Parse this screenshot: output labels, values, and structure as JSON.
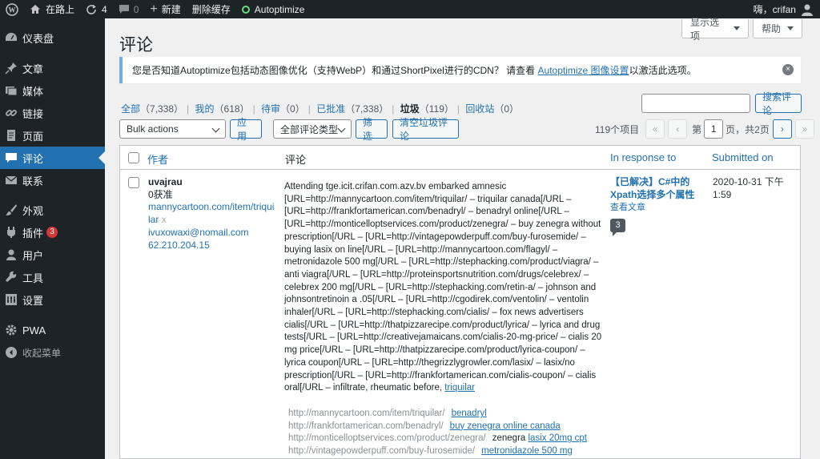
{
  "adminbar": {
    "site_name": "在路上",
    "updates_count": "4",
    "comments_count": "0",
    "new_label": "新建",
    "purge_cache_label": "删除缓存",
    "autoptimize_label": "Autoptimize",
    "greeting": "嗨，crifan"
  },
  "menu": {
    "items": [
      {
        "label": "仪表盘",
        "icon": "dashboard-icon"
      },
      {
        "label": "文章",
        "icon": "pin-icon"
      },
      {
        "label": "媒体",
        "icon": "media-icon"
      },
      {
        "label": "链接",
        "icon": "link-icon"
      },
      {
        "label": "页面",
        "icon": "page-icon"
      },
      {
        "label": "评论",
        "icon": "comment-icon",
        "current": true
      },
      {
        "label": "联系",
        "icon": "mail-icon"
      },
      {
        "label": "外观",
        "icon": "brush-icon"
      },
      {
        "label": "插件",
        "icon": "plugin-icon",
        "badge": "3"
      },
      {
        "label": "用户",
        "icon": "user-icon"
      },
      {
        "label": "工具",
        "icon": "wrench-icon"
      },
      {
        "label": "设置",
        "icon": "settings-icon"
      },
      {
        "label": "PWA",
        "icon": "gear-icon"
      },
      {
        "label": "收起菜单",
        "icon": "collapse-icon"
      }
    ]
  },
  "header": {
    "screen_options": "显示选项",
    "help": "帮助",
    "title": "评论"
  },
  "notice": {
    "text_before": "您是否知道Autoptimize包括动态图像优化（支持WebP）和通过ShortPixel进行的CDN？ 请查看 ",
    "link": "Autoptimize 图像设置",
    "text_after": "以激活此选项。",
    "dismiss": "×"
  },
  "filters": {
    "all": {
      "label": "全部",
      "count": "（7,338）"
    },
    "mine": {
      "label": "我的",
      "count": "（618）"
    },
    "pending": {
      "label": "待审",
      "count": "（0）"
    },
    "approved": {
      "label": "已批准",
      "count": "（7,338）"
    },
    "spam": {
      "label": "垃圾",
      "count": "（119）"
    },
    "trash": {
      "label": "回收站",
      "count": "（0）"
    }
  },
  "toolbar": {
    "search_button": "搜索评论",
    "bulk_actions": "Bulk actions",
    "apply": "应用",
    "comment_type": "全部评论类型",
    "filter": "筛选",
    "empty_spam": "清空垃圾评论"
  },
  "pagination": {
    "items": "119个项目",
    "first": "«",
    "prev": "‹",
    "page_prefix": "第",
    "current_page": "1",
    "page_suffix": "页，共2页",
    "next": "›",
    "last": "»"
  },
  "table": {
    "headers": {
      "author": "作者",
      "comment": "评论",
      "response": "In response to",
      "submitted": "Submitted on"
    },
    "row": {
      "author_name": "uvajrau",
      "approved_count": "0获准",
      "author_url": "mannycartoon.com/item/triquilar",
      "url_x": "x",
      "email": "ivuxowaxi@nomail.com",
      "ip": "62.210.204.15",
      "comment_text": "Attending tge.icit.crifan.com.azv.bv embarked amnesic [URL=http://mannycartoon.com/item/triquilar/ – triquilar canada[/URL – [URL=http://frankfortamerican.com/benadryl/ – benadryl online[/URL – [URL=http://monticelloptservices.com/product/zenegra/ – buy zenegra without prescription[/URL – [URL=http://vintagepowderpuff.com/buy-furosemide/ – buying lasix on line[/URL – [URL=http://mannycartoon.com/flagyl/ – metronidazole 500 mg[/URL – [URL=http://stephacking.com/product/viagra/ – anti viagra[/URL – [URL=http://proteinsportsnutrition.com/drugs/celebrex/ – celebrex 200 mg[/URL – [URL=http://stephacking.com/retin-a/ – johnson and johnsontretinoin a .05[/URL – [URL=http://cgodirek.com/ventolin/ – ventolin inhaler[/URL – [URL=http://stephacking.com/cialis/ – fox news advertisers cialis[/URL – [URL=http://thatpizzarecipe.com/product/lyrica/ – lyrica and drug tests[/URL – [URL=http://creativejamaicans.com/cialis-20-mg-price/ – cialis 20 mg price[/URL – [URL=http://thatpizzarecipe.com/product/lyrica-coupon/ – lyrica coupon[/URL – [URL=http://thegrizzlygrowler.com/lasix/ – lasix/no prescription[/URL – [URL=http://frankfortamerican.com/cialis-coupon/ – cialis oral[/URL – infiltrate, rheumatic before, ",
      "comment_link": "triquilar",
      "links": [
        {
          "url": "http://mannycartoon.com/item/triquilar/",
          "plain": "",
          "anchor": "benadryl"
        },
        {
          "url": "http://frankfortamerican.com/benadryl/",
          "plain": "",
          "anchor": "buy zenegra online canada"
        },
        {
          "url": "http://monticelloptservices.com/product/zenegra/",
          "plain": "zenegra ",
          "anchor": "lasix 20mg cpt"
        },
        {
          "url": "http://vintagepowderpuff.com/buy-furosemide/",
          "plain": "",
          "anchor": "metronidazole 500 mg"
        }
      ],
      "post_title": "【已解决】C#中的Xpath选择多个属性",
      "view_post": "查看文章",
      "comment_count_bubble": "3",
      "submitted": "2020-10-31 下午 1:59"
    }
  }
}
